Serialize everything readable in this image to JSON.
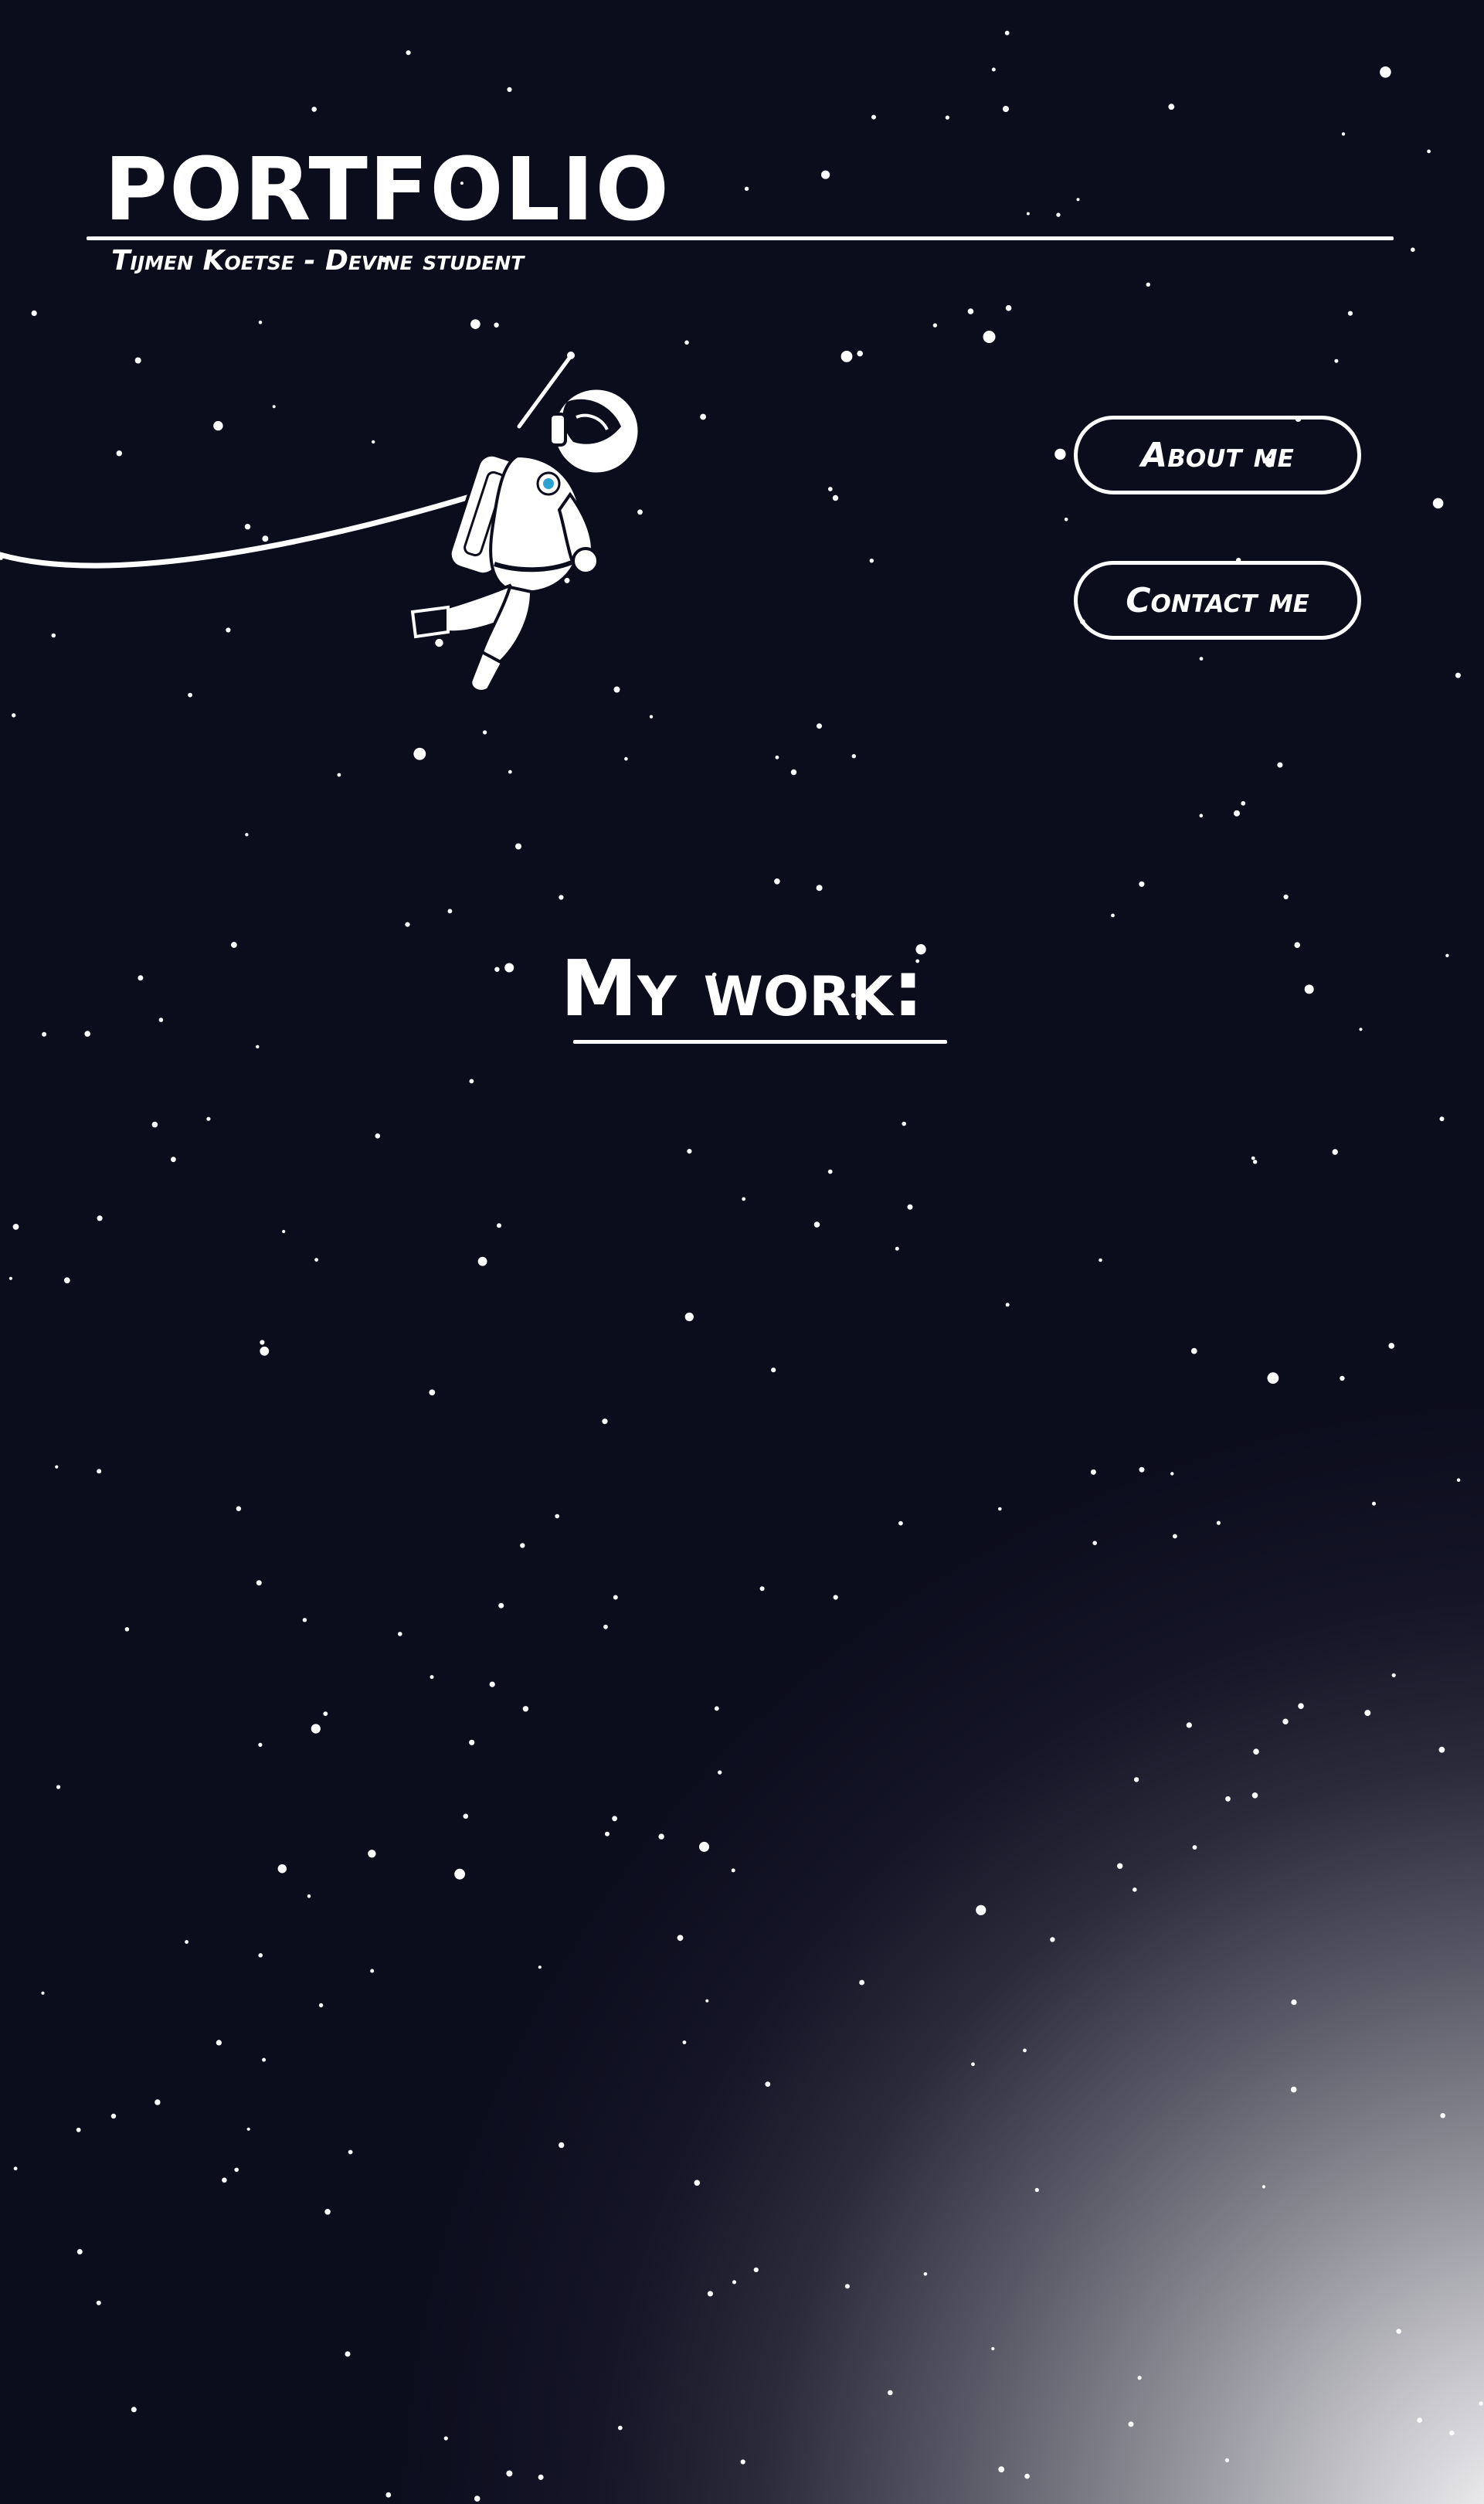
{
  "header": {
    "title": "PORTFOLIO",
    "subtitle": "Tijmen Koetse - Devine student"
  },
  "nav": {
    "about_label": "About me",
    "contact_label": "Contact me"
  },
  "main": {
    "section_title": "My work:"
  },
  "colors": {
    "background": "#0b0c1c",
    "foreground": "#ffffff",
    "planet_glow": "#ffffff"
  },
  "icons": {
    "astronaut": "astronaut-illustration",
    "tether": "tether-line"
  }
}
